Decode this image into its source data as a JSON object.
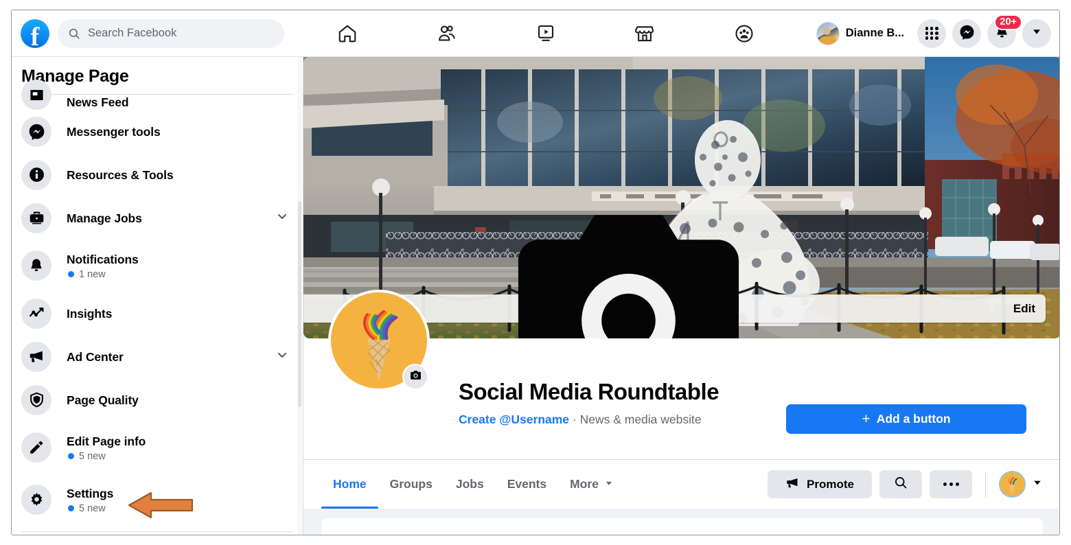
{
  "header": {
    "logo": "facebook-logo",
    "search": {
      "placeholder": "Search Facebook",
      "icon": "search-icon"
    },
    "nav": [
      {
        "name": "home",
        "icon": "home-icon"
      },
      {
        "name": "friends",
        "icon": "friends-icon"
      },
      {
        "name": "watch",
        "icon": "video-play-icon"
      },
      {
        "name": "marketplace",
        "icon": "storefront-icon"
      },
      {
        "name": "groups",
        "icon": "groups-icon"
      }
    ],
    "profile_name": "Dianne B...",
    "menu_icon": "grid-menu-icon",
    "messenger_icon": "messenger-icon",
    "notifications_icon": "bell-icon",
    "notifications_badge": "20+",
    "account_icon": "chevron-down-icon"
  },
  "sidebar": {
    "title": "Manage Page",
    "items": [
      {
        "label": "News Feed",
        "icon": "news-feed-icon",
        "sub": "",
        "chevron": false,
        "clipped": true
      },
      {
        "label": "Messenger tools",
        "icon": "messenger-icon",
        "sub": "",
        "chevron": false
      },
      {
        "label": "Resources & Tools",
        "icon": "info-icon",
        "sub": "",
        "chevron": false
      },
      {
        "label": "Manage Jobs",
        "icon": "briefcase-icon",
        "sub": "",
        "chevron": true
      },
      {
        "label": "Notifications",
        "icon": "bell-icon",
        "sub": "1 new",
        "chevron": false
      },
      {
        "label": "Insights",
        "icon": "insights-chart-icon",
        "sub": "",
        "chevron": false
      },
      {
        "label": "Ad Center",
        "icon": "megaphone-icon",
        "sub": "",
        "chevron": true
      },
      {
        "label": "Page Quality",
        "icon": "shield-icon",
        "sub": "",
        "chevron": false
      },
      {
        "label": "Edit Page info",
        "icon": "pencil-icon",
        "sub": "5 new",
        "chevron": false
      },
      {
        "label": "Settings",
        "icon": "gear-icon",
        "sub": "5 new",
        "chevron": false
      }
    ],
    "annotation_arrow": "orange-arrow-pointing-to-settings"
  },
  "cover": {
    "image_description": "concrete modernist building with glass windows, bike racks, steps, lawn with autumn leaves and a white wire-mesh seated figure sculpture",
    "edit_label": "Edit",
    "edit_icon": "camera-icon"
  },
  "profile": {
    "avatar_description": "waffle ice cream cone with rainbow ribbons on orange background",
    "avatar_camera_icon": "camera-icon",
    "name": "Social Media Roundtable",
    "username_link": "Create @Username",
    "meta_separator": " · ",
    "category": "News & media website",
    "cta_label": "Add a button",
    "cta_plus": "+"
  },
  "tabs": {
    "items": [
      {
        "label": "Home",
        "active": true
      },
      {
        "label": "Groups",
        "active": false
      },
      {
        "label": "Jobs",
        "active": false
      },
      {
        "label": "Events",
        "active": false
      },
      {
        "label": "More",
        "active": false,
        "caret": true
      }
    ],
    "promote_label": "Promote",
    "promote_icon": "megaphone-icon",
    "search_icon": "search-icon",
    "more_icon": "ellipsis-icon",
    "page_switch_icon": "chevron-down-icon"
  },
  "colors": {
    "brand_blue": "#1877f2",
    "badge_red": "#f02849",
    "surface_gray": "#e4e6eb",
    "page_bg": "#f0f2f5",
    "text_primary": "#050505",
    "text_secondary": "#65676b",
    "annotation_orange": "#e2813f",
    "annotation_orange_border": "#9c5a28"
  }
}
